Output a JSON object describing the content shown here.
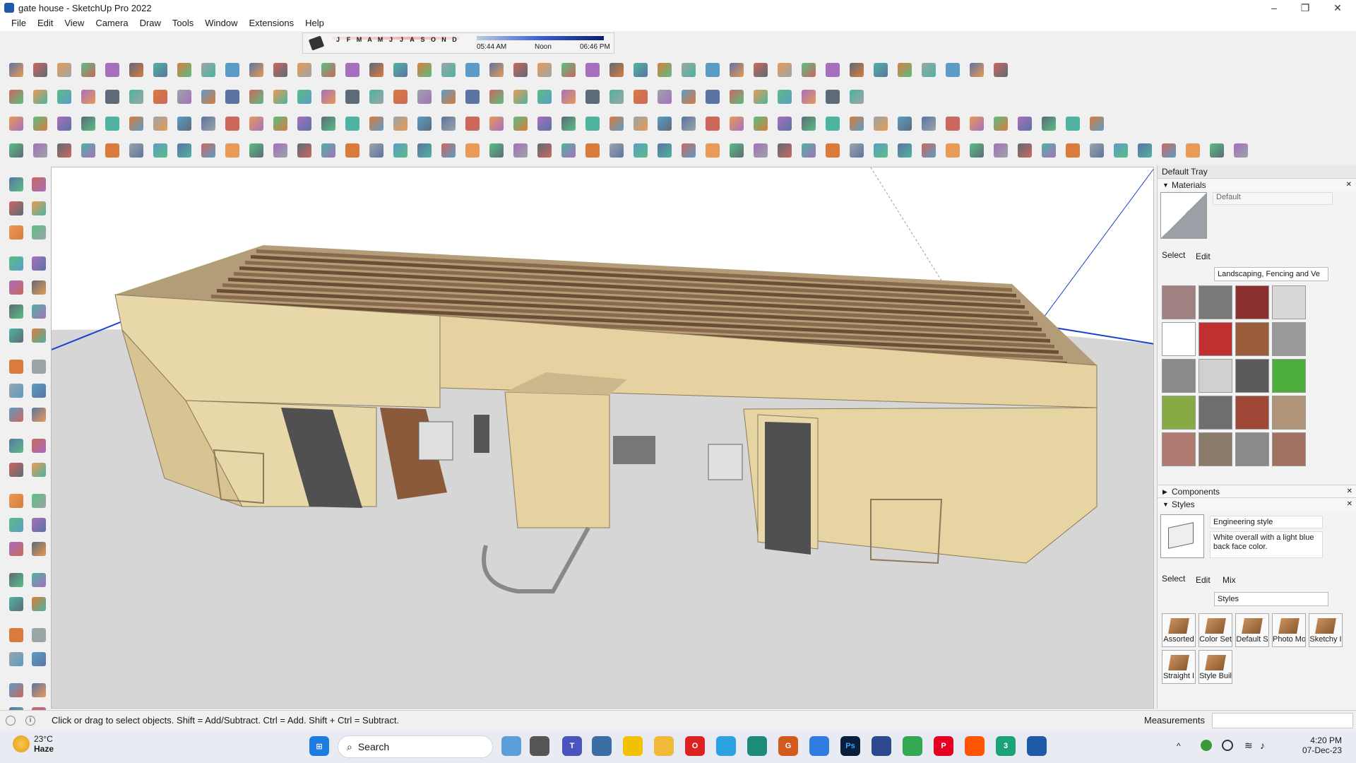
{
  "window": {
    "title": "gate house - SketchUp Pro 2022",
    "controls": [
      "–",
      "❐",
      "✕"
    ]
  },
  "menu": [
    "File",
    "Edit",
    "View",
    "Camera",
    "Draw",
    "Tools",
    "Window",
    "Extensions",
    "Help"
  ],
  "shadow": {
    "months": [
      "J",
      "F",
      "M",
      "A",
      "M",
      "J",
      "J",
      "A",
      "S",
      "O",
      "N",
      "D"
    ],
    "time_start": "05:44 AM",
    "time_mid": "Noon",
    "time_end": "06:46 PM"
  },
  "tray": {
    "title": "Default Tray",
    "materials": {
      "header": "Materials",
      "current": "Default",
      "tabs": [
        "Select",
        "Edit"
      ],
      "library": "Landscaping, Fencing and Ve",
      "swatch_colors": [
        "#a08080",
        "#7a7a7a",
        "#8b2f2f",
        "#d7d7d7",
        "#ffffff",
        "#c03030",
        "#9b5c3c",
        "#9a9a9a",
        "#8a8a8a",
        "#d0d0d0",
        "#5a5a5a",
        "#4caf3c",
        "#88aa44",
        "#6e6e6e",
        "#a04838",
        "#b09478",
        "#b07a70",
        "#8a7a6a",
        "#8a8a8a",
        "#a07060"
      ]
    },
    "components": {
      "header": "Components"
    },
    "styles": {
      "header": "Styles",
      "name": "Engineering style",
      "description": "White overall with a light blue back face color.",
      "tabs": [
        "Select",
        "Edit",
        "Mix"
      ],
      "library": "Styles",
      "items": [
        "Assorted",
        "Color Set",
        "Default S",
        "Photo Mo",
        "Sketchy I",
        "Straight I",
        "Style Buil"
      ]
    }
  },
  "status": {
    "message": "Click or drag to select objects. Shift = Add/Subtract. Ctrl = Add. Shift + Ctrl = Subtract.",
    "measurements_label": "Measurements"
  },
  "taskbar": {
    "weather_temp": "23°C",
    "weather_desc": "Haze",
    "search_label": "Search",
    "time": "4:20 PM",
    "date": "07-Dec-23"
  }
}
